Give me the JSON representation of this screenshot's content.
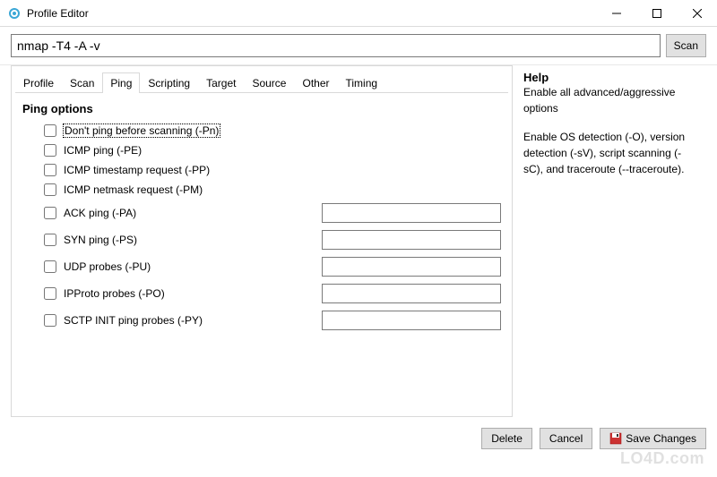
{
  "window": {
    "title": "Profile Editor"
  },
  "command": {
    "value": "nmap -T4 -A -v",
    "scan_label": "Scan"
  },
  "tabs": [
    {
      "label": "Profile"
    },
    {
      "label": "Scan"
    },
    {
      "label": "Ping"
    },
    {
      "label": "Scripting"
    },
    {
      "label": "Target"
    },
    {
      "label": "Source"
    },
    {
      "label": "Other"
    },
    {
      "label": "Timing"
    }
  ],
  "active_tab_index": 2,
  "ping": {
    "section_title": "Ping options",
    "options": [
      {
        "label": "Don't ping before scanning (-Pn)",
        "checked": false,
        "has_input": false,
        "selected": true
      },
      {
        "label": "ICMP ping (-PE)",
        "checked": false,
        "has_input": false
      },
      {
        "label": "ICMP timestamp request (-PP)",
        "checked": false,
        "has_input": false
      },
      {
        "label": "ICMP netmask request (-PM)",
        "checked": false,
        "has_input": false
      },
      {
        "label": "ACK ping (-PA)",
        "checked": false,
        "has_input": true,
        "value": ""
      },
      {
        "label": "SYN ping (-PS)",
        "checked": false,
        "has_input": true,
        "value": ""
      },
      {
        "label": "UDP probes (-PU)",
        "checked": false,
        "has_input": true,
        "value": ""
      },
      {
        "label": "IPProto probes (-PO)",
        "checked": false,
        "has_input": true,
        "value": ""
      },
      {
        "label": "SCTP INIT ping probes (-PY)",
        "checked": false,
        "has_input": true,
        "value": ""
      }
    ]
  },
  "help": {
    "title": "Help",
    "body_line1": "Enable all advanced/aggressive options",
    "body_line2": "Enable OS detection (-O), version detection (-sV), script scanning (-sC), and traceroute (--traceroute)."
  },
  "footer": {
    "delete_label": "Delete",
    "cancel_label": "Cancel",
    "save_label": "Save Changes"
  },
  "watermark": "LO4D.com"
}
